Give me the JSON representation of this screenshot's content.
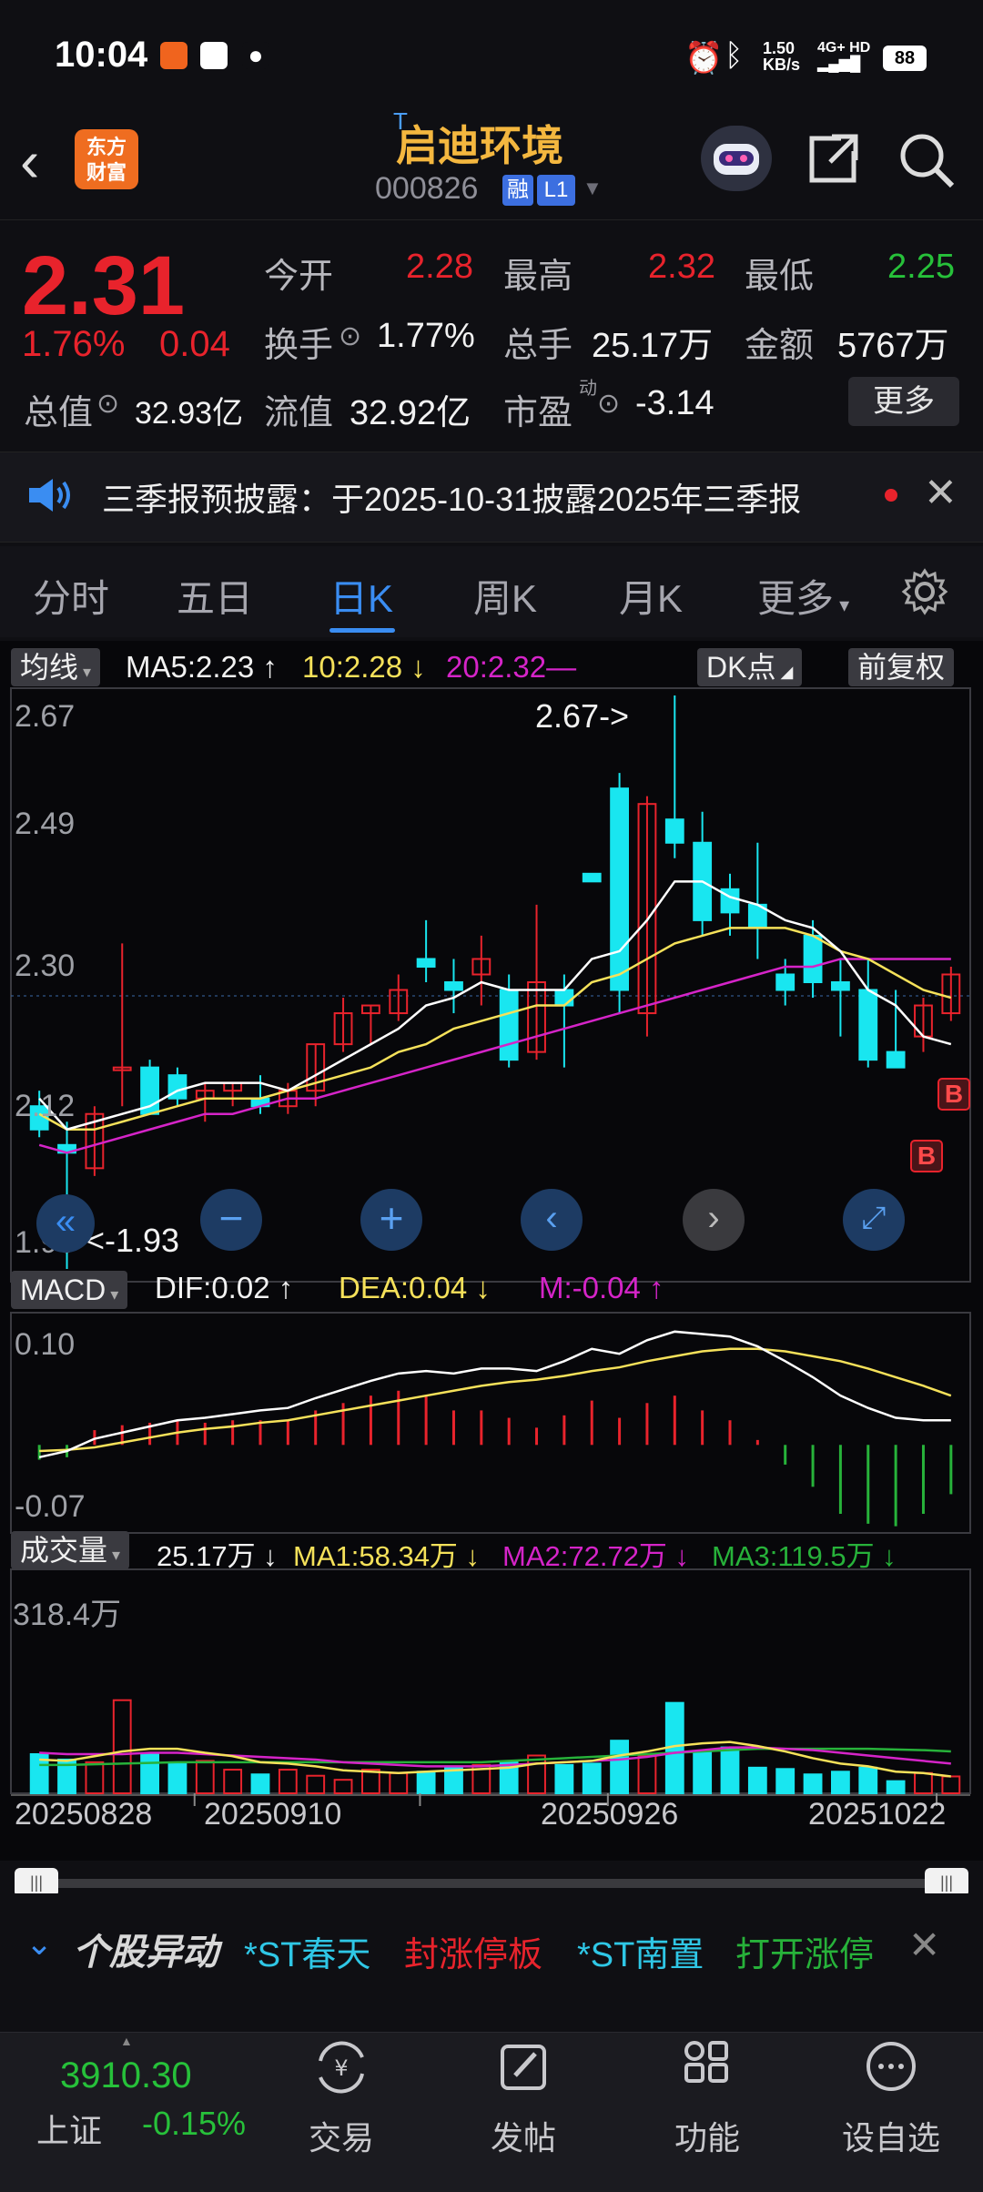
{
  "status_bar": {
    "time": "10:04",
    "net_speed": "1.50",
    "net_unit": "KB/s",
    "network": "4G+ HD",
    "battery": "88"
  },
  "header": {
    "logo_line1": "东方",
    "logo_line2": "财富",
    "t_mark": "T",
    "stock_name": "启迪环境",
    "stock_code": "000826",
    "tag_rong": "融",
    "tag_l1": "L1"
  },
  "quote": {
    "price": "2.31",
    "change_pct": "1.76%",
    "change": "0.04",
    "open_label": "今开",
    "open": "2.28",
    "high_label": "最高",
    "high": "2.32",
    "low_label": "最低",
    "low": "2.25",
    "turnover_label": "换手",
    "turnover": "1.77%",
    "volume_label": "总手",
    "volume": "25.17万",
    "amount_label": "金额",
    "amount": "5767万",
    "mktcap_label": "总值",
    "mktcap": "32.93亿",
    "float_label": "流值",
    "float_cap": "32.92亿",
    "pe_label": "市盈",
    "pe_sup": "动",
    "pe": "-3.14",
    "more": "更多"
  },
  "notice": {
    "text": "三季报预披露：于2025-10-31披露2025年三季报"
  },
  "tabs": [
    "分时",
    "五日",
    "日K",
    "周K",
    "月K",
    "更多"
  ],
  "tabs_active": 2,
  "chart": {
    "ma_select": "均线",
    "ma5": "MA5:2.23",
    "ma10": "10:2.28",
    "ma20": "20:2.32",
    "dk_btn": "DK点",
    "fuquan_btn": "前复权",
    "price_axis": [
      "2.67",
      "2.49",
      "2.30",
      "2.12",
      "1.93"
    ],
    "max_marker": "2.67->",
    "min_marker": "<-1.93",
    "b_label": "B",
    "macd_select": "MACD",
    "dif": "DIF:0.02",
    "dea": "DEA:0.04",
    "m": "M:-0.04",
    "macd_axis_top": "0.10",
    "macd_axis_bottom": "-0.07",
    "vol_select": "成交量",
    "vol": "25.17万",
    "vol_ma1": "MA1:58.34万",
    "vol_ma2": "MA2:72.72万",
    "vol_ma3": "MA3:119.5万",
    "vol_axis_top": "318.4万",
    "dates": [
      "20250828",
      "20250910",
      "20250926",
      "20251022"
    ],
    "colors": {
      "up": "#e8232c",
      "down": "#19e6f0",
      "ma5": "#ffffff",
      "ma10": "#f5e15a",
      "ma20": "#d524c8",
      "macd_down": "#27b23a"
    }
  },
  "chart_data": {
    "type": "candlestick",
    "title": "",
    "candles": [
      {
        "o": 2.14,
        "h": 2.16,
        "l": 2.1,
        "c": 2.11
      },
      {
        "o": 2.09,
        "h": 2.12,
        "l": 1.93,
        "c": 2.08
      },
      {
        "o": 2.06,
        "h": 2.14,
        "l": 2.05,
        "c": 2.13
      },
      {
        "o": 2.19,
        "h": 2.35,
        "l": 2.14,
        "c": 2.19
      },
      {
        "o": 2.19,
        "h": 2.2,
        "l": 2.13,
        "c": 2.13
      },
      {
        "o": 2.18,
        "h": 2.19,
        "l": 2.14,
        "c": 2.15
      },
      {
        "o": 2.15,
        "h": 2.17,
        "l": 2.12,
        "c": 2.16
      },
      {
        "o": 2.16,
        "h": 2.17,
        "l": 2.14,
        "c": 2.17
      },
      {
        "o": 2.15,
        "h": 2.18,
        "l": 2.13,
        "c": 2.14
      },
      {
        "o": 2.14,
        "h": 2.17,
        "l": 2.13,
        "c": 2.16
      },
      {
        "o": 2.16,
        "h": 2.22,
        "l": 2.14,
        "c": 2.22
      },
      {
        "o": 2.22,
        "h": 2.28,
        "l": 2.21,
        "c": 2.26
      },
      {
        "o": 2.26,
        "h": 2.27,
        "l": 2.22,
        "c": 2.27
      },
      {
        "o": 2.26,
        "h": 2.31,
        "l": 2.25,
        "c": 2.29
      },
      {
        "o": 2.33,
        "h": 2.38,
        "l": 2.3,
        "c": 2.32
      },
      {
        "o": 2.3,
        "h": 2.33,
        "l": 2.26,
        "c": 2.29
      },
      {
        "o": 2.31,
        "h": 2.36,
        "l": 2.27,
        "c": 2.33
      },
      {
        "o": 2.29,
        "h": 2.31,
        "l": 2.19,
        "c": 2.2
      },
      {
        "o": 2.21,
        "h": 2.4,
        "l": 2.2,
        "c": 2.3
      },
      {
        "o": 2.29,
        "h": 2.31,
        "l": 2.19,
        "c": 2.27
      },
      {
        "o": 2.44,
        "h": 2.44,
        "l": 2.43,
        "c": 2.43
      },
      {
        "o": 2.55,
        "h": 2.57,
        "l": 2.26,
        "c": 2.29
      },
      {
        "o": 2.26,
        "h": 2.54,
        "l": 2.23,
        "c": 2.53
      },
      {
        "o": 2.51,
        "h": 2.67,
        "l": 2.46,
        "c": 2.48
      },
      {
        "o": 2.48,
        "h": 2.52,
        "l": 2.36,
        "c": 2.38
      },
      {
        "o": 2.42,
        "h": 2.44,
        "l": 2.36,
        "c": 2.39
      },
      {
        "o": 2.4,
        "h": 2.48,
        "l": 2.33,
        "c": 2.37
      },
      {
        "o": 2.31,
        "h": 2.33,
        "l": 2.27,
        "c": 2.29
      },
      {
        "o": 2.36,
        "h": 2.38,
        "l": 2.28,
        "c": 2.3
      },
      {
        "o": 2.3,
        "h": 2.33,
        "l": 2.23,
        "c": 2.29
      },
      {
        "o": 2.29,
        "h": 2.33,
        "l": 2.19,
        "c": 2.2
      },
      {
        "o": 2.21,
        "h": 2.29,
        "l": 2.19,
        "c": 2.19
      },
      {
        "o": 2.23,
        "h": 2.28,
        "l": 2.21,
        "c": 2.27
      },
      {
        "o": 2.26,
        "h": 2.32,
        "l": 2.25,
        "c": 2.31
      }
    ],
    "ma5": [
      2.15,
      2.11,
      2.12,
      2.13,
      2.14,
      2.16,
      2.17,
      2.17,
      2.17,
      2.16,
      2.18,
      2.2,
      2.22,
      2.24,
      2.27,
      2.28,
      2.3,
      2.29,
      2.29,
      2.29,
      2.33,
      2.34,
      2.38,
      2.43,
      2.43,
      2.41,
      2.4,
      2.38,
      2.37,
      2.34,
      2.29,
      2.27,
      2.23,
      2.22
    ],
    "ma10": [
      2.13,
      2.11,
      2.11,
      2.12,
      2.13,
      2.14,
      2.15,
      2.15,
      2.15,
      2.16,
      2.17,
      2.18,
      2.19,
      2.21,
      2.22,
      2.24,
      2.25,
      2.26,
      2.27,
      2.27,
      2.3,
      2.31,
      2.33,
      2.35,
      2.36,
      2.37,
      2.37,
      2.37,
      2.36,
      2.34,
      2.33,
      2.31,
      2.29,
      2.28
    ],
    "ma20": [
      2.09,
      2.08,
      2.09,
      2.1,
      2.11,
      2.12,
      2.13,
      2.13,
      2.14,
      2.15,
      2.15,
      2.16,
      2.17,
      2.18,
      2.19,
      2.2,
      2.21,
      2.22,
      2.23,
      2.24,
      2.25,
      2.26,
      2.27,
      2.28,
      2.29,
      2.3,
      2.31,
      2.32,
      2.32,
      2.33,
      2.33,
      2.33,
      2.33,
      2.33
    ],
    "ylim": [
      1.93,
      2.67
    ],
    "macd": {
      "dif": [
        -0.01,
        -0.005,
        0.005,
        0.01,
        0.015,
        0.02,
        0.022,
        0.025,
        0.028,
        0.03,
        0.038,
        0.045,
        0.052,
        0.058,
        0.06,
        0.058,
        0.062,
        0.062,
        0.06,
        0.068,
        0.078,
        0.074,
        0.085,
        0.092,
        0.09,
        0.088,
        0.08,
        0.068,
        0.055,
        0.04,
        0.03,
        0.022,
        0.02,
        0.02
      ],
      "dea": [
        -0.005,
        -0.004,
        -0.002,
        0.002,
        0.006,
        0.01,
        0.013,
        0.015,
        0.018,
        0.02,
        0.024,
        0.028,
        0.032,
        0.036,
        0.04,
        0.044,
        0.048,
        0.051,
        0.053,
        0.056,
        0.06,
        0.063,
        0.068,
        0.072,
        0.076,
        0.078,
        0.078,
        0.076,
        0.072,
        0.068,
        0.062,
        0.055,
        0.048,
        0.04
      ],
      "m": [
        -0.012,
        -0.01,
        0.012,
        0.016,
        0.018,
        0.02,
        0.018,
        0.02,
        0.02,
        0.02,
        0.028,
        0.034,
        0.04,
        0.044,
        0.04,
        0.028,
        0.028,
        0.022,
        0.014,
        0.024,
        0.036,
        0.022,
        0.034,
        0.04,
        0.028,
        0.02,
        0.004,
        -0.016,
        -0.034,
        -0.056,
        -0.064,
        -0.066,
        -0.056,
        -0.04
      ],
      "ylim": [
        -0.07,
        0.1
      ]
    },
    "volume": {
      "values": [
        58,
        50,
        46,
        138,
        58,
        44,
        48,
        35,
        28,
        35,
        26,
        20,
        35,
        30,
        32,
        38,
        42,
        46,
        56,
        42,
        44,
        78,
        56,
        134,
        62,
        68,
        38,
        36,
        28,
        32,
        38,
        18,
        30,
        25
      ],
      "ma1": [
        50,
        48,
        55,
        62,
        66,
        66,
        60,
        55,
        46,
        44,
        40,
        34,
        32,
        30,
        32,
        34,
        36,
        38,
        44,
        46,
        48,
        56,
        62,
        70,
        74,
        76,
        70,
        62,
        52,
        44,
        40,
        32,
        30,
        25
      ],
      "ma2": [
        60,
        58,
        58,
        58,
        60,
        60,
        58,
        56,
        54,
        52,
        50,
        46,
        44,
        42,
        40,
        40,
        40,
        42,
        44,
        46,
        48,
        50,
        54,
        60,
        64,
        68,
        68,
        66,
        64,
        60,
        56,
        52,
        48,
        44
      ],
      "ma3": [
        42,
        42,
        43,
        44,
        45,
        46,
        46,
        46,
        46,
        46,
        46,
        46,
        46,
        46,
        46,
        46,
        46,
        48,
        50,
        52,
        54,
        56,
        58,
        60,
        62,
        64,
        66,
        66,
        66,
        66,
        66,
        65,
        64,
        62
      ],
      "ylim": [
        0,
        318.4
      ]
    }
  },
  "tape": {
    "title": "个股异动",
    "items": [
      "*ST春天",
      "封涨停板",
      "*ST南置",
      "打开涨停"
    ]
  },
  "bottom_nav": {
    "index_value": "3910.30",
    "index_name": "上证",
    "index_change": "-0.15%",
    "items": [
      "交易",
      "发帖",
      "功能",
      "设自选"
    ]
  }
}
